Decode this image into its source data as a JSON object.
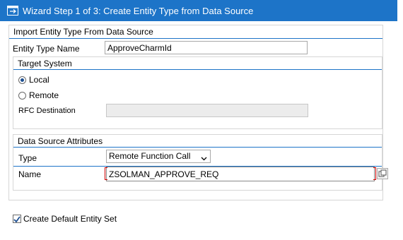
{
  "window": {
    "title": "Wizard Step 1 of 3: Create Entity Type from Data Source",
    "title_icon": "wizard-window-icon"
  },
  "import_group": {
    "title": "Import Entity Type From Data Source",
    "entity_type_name_label": "Entity Type Name",
    "entity_type_name_value": "ApproveCharmId"
  },
  "target_system": {
    "title": "Target System",
    "local_label": "Local",
    "remote_label": "Remote",
    "selected": "Local",
    "rfc_destination_label": "RFC Destination",
    "rfc_destination_value": ""
  },
  "data_source": {
    "title": "Data Source Attributes",
    "type_label": "Type",
    "type_value": "Remote Function Call",
    "name_label": "Name",
    "name_value": "ZSOLMAN_APPROVE_REQ"
  },
  "options": {
    "create_default_entity_set_label": "Create Default Entity Set",
    "create_default_entity_set_checked": true
  },
  "colors": {
    "title_bar": "#1d74c8",
    "group_line": "#1d74c8",
    "required_marker": "#d10000"
  }
}
